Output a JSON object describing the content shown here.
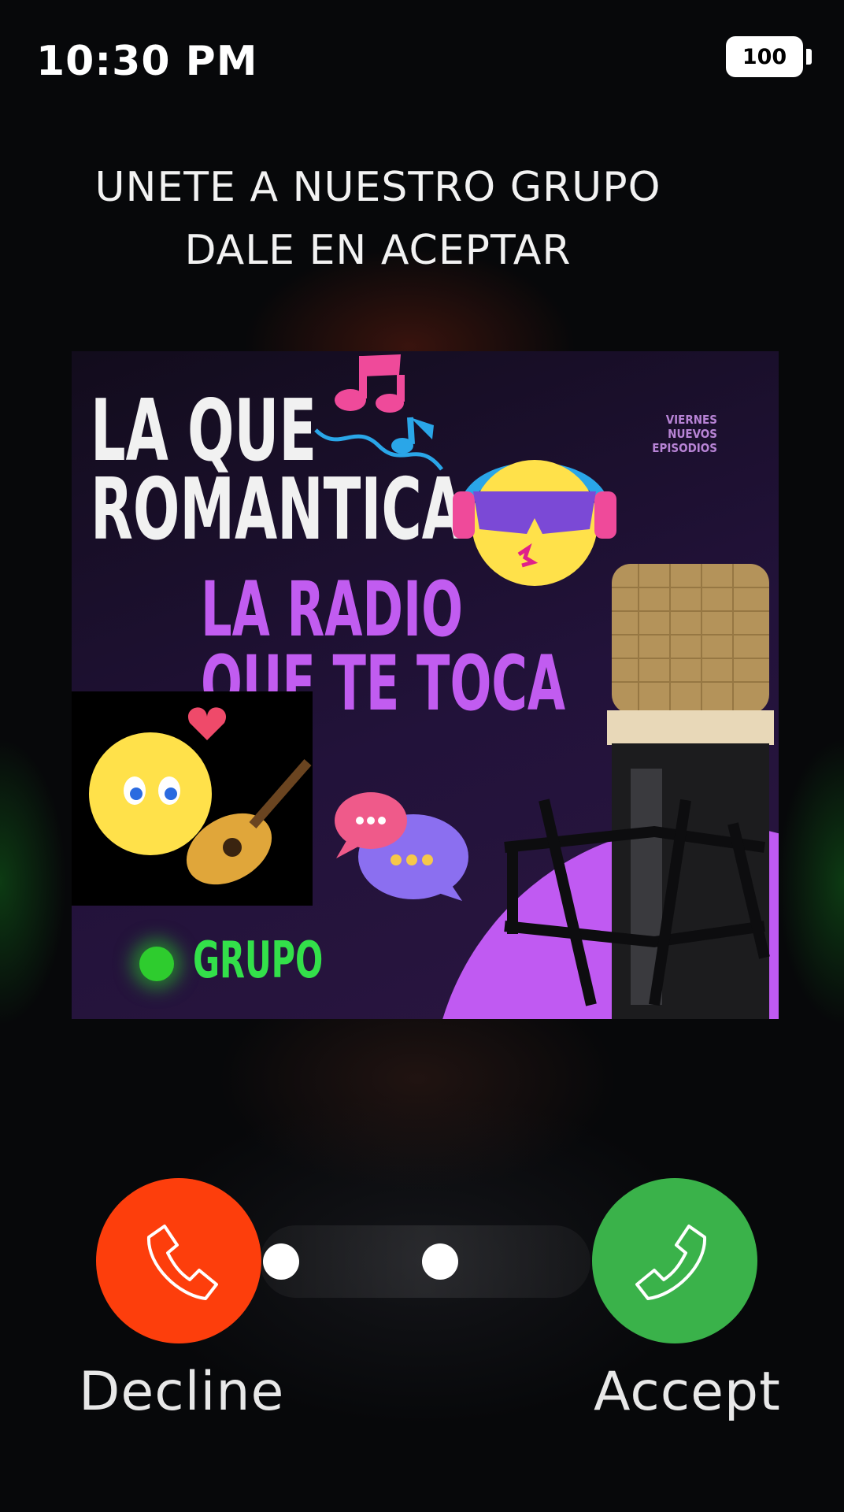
{
  "status_bar": {
    "time": "10:30 PM",
    "battery": "100"
  },
  "prompt": {
    "line1": "UNETE A NUESTRO GRUPO",
    "line2": "DALE EN ACEPTAR"
  },
  "poster": {
    "title_line1": "LA QUE",
    "title_line2": "ROMANTICA",
    "subtitle_line1": "LA RADIO",
    "subtitle_line2": "QUE TE TOCA",
    "side_note": [
      "VIERNES",
      "NUEVOS",
      "EPISODIOS"
    ],
    "group_label": "GRUPO",
    "colors": {
      "title": "#f1f1f1",
      "subtitle": "#c15cf0",
      "group": "#33e04a"
    }
  },
  "actions": {
    "decline_label": "Decline",
    "accept_label": "Accept",
    "decline_color": "#fd3e0c",
    "accept_color": "#3ab24a",
    "decline_icon": "phone-icon",
    "accept_icon": "phone-icon"
  }
}
